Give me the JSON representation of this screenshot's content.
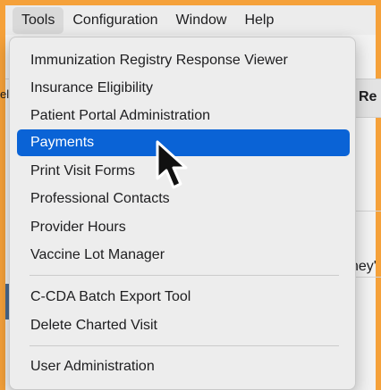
{
  "menubar": {
    "items": [
      {
        "label": "Tools",
        "open": true
      },
      {
        "label": "Configuration",
        "open": false
      },
      {
        "label": "Window",
        "open": false
      },
      {
        "label": "Help",
        "open": false
      }
    ]
  },
  "background": {
    "fragment_right_header": "Re",
    "fragment_right_text": "ney'",
    "fragment_left_text": "el"
  },
  "tools_menu": {
    "groups": [
      [
        {
          "label": "Immunization Registry Response Viewer"
        },
        {
          "label": "Insurance Eligibility"
        },
        {
          "label": "Patient Portal Administration"
        },
        {
          "label": "Payments",
          "selected": true
        },
        {
          "label": "Print Visit Forms"
        },
        {
          "label": "Professional Contacts"
        },
        {
          "label": "Provider Hours"
        },
        {
          "label": "Vaccine Lot Manager"
        }
      ],
      [
        {
          "label": "C-CDA Batch Export Tool"
        },
        {
          "label": "Delete Charted Visit"
        }
      ],
      [
        {
          "label": "User Administration"
        }
      ]
    ]
  },
  "icons": {
    "cursor": "arrow-pointer-icon"
  },
  "colors": {
    "background_orange": "#f5a13a",
    "menu_background": "#ededed",
    "selection_blue": "#0a63d6"
  }
}
